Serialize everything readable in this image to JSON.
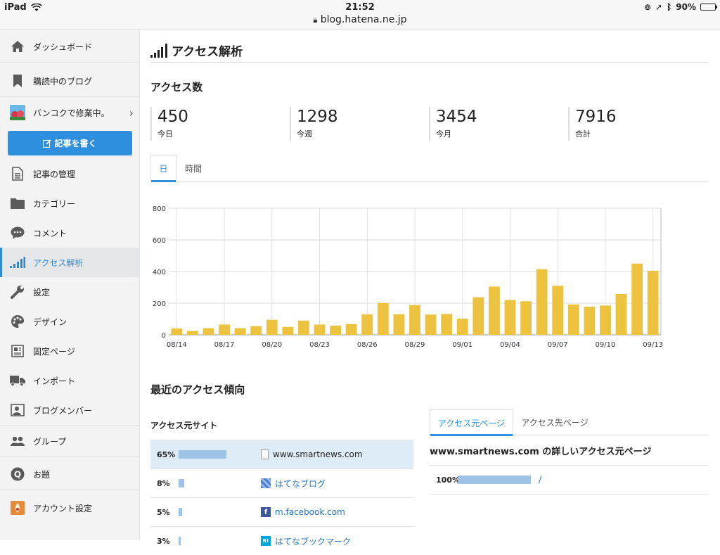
{
  "status_bar": {
    "device": "iPad",
    "time": "21:52",
    "url": "blog.hatena.ne.jp",
    "battery": "90%"
  },
  "sidebar": {
    "items": [
      {
        "label": "ダッシュボード",
        "icon": "home-icon"
      },
      {
        "label": "購読中のブログ",
        "icon": "bookmark-icon"
      },
      {
        "label": "バンコクで修業中。",
        "icon": "blog-avatar-icon"
      },
      {
        "label": "記事の管理",
        "icon": "document-icon"
      },
      {
        "label": "カテゴリー",
        "icon": "folder-icon"
      },
      {
        "label": "コメント",
        "icon": "comment-icon"
      },
      {
        "label": "アクセス解析",
        "icon": "signal-icon"
      },
      {
        "label": "設定",
        "icon": "wrench-icon"
      },
      {
        "label": "デザイン",
        "icon": "palette-icon"
      },
      {
        "label": "固定ページ",
        "icon": "page-icon"
      },
      {
        "label": "インポート",
        "icon": "truck-icon"
      },
      {
        "label": "ブログメンバー",
        "icon": "members-icon"
      },
      {
        "label": "グループ",
        "icon": "group-icon"
      },
      {
        "label": "お題",
        "icon": "question-icon"
      },
      {
        "label": "アカウント設定",
        "icon": "account-icon"
      }
    ],
    "write_button": "記事を書く"
  },
  "main": {
    "title": "アクセス解析",
    "access_heading": "アクセス数",
    "stats": [
      {
        "value": "450",
        "label": "今日"
      },
      {
        "value": "1298",
        "label": "今週"
      },
      {
        "value": "3454",
        "label": "今月"
      },
      {
        "value": "7916",
        "label": "合計"
      }
    ],
    "tabs": [
      "日",
      "時間"
    ],
    "trend_heading": "最近のアクセス傾向",
    "sources_heading": "アクセス元サイト",
    "sources": [
      {
        "pct": "65%",
        "value": 65,
        "site": "www.smartnews.com",
        "icon": "page-icon"
      },
      {
        "pct": "8%",
        "value": 8,
        "site": "はてなブログ",
        "icon": "hatena-blog-icon"
      },
      {
        "pct": "5%",
        "value": 5,
        "site": "m.facebook.com",
        "icon": "facebook-icon"
      },
      {
        "pct": "3%",
        "value": 3,
        "site": "はてなブックマーク",
        "icon": "hatena-bookmark-icon"
      }
    ],
    "right_tabs": [
      "アクセス元ページ",
      "アクセス先ページ"
    ],
    "detail_heading": "www.smartnews.com の詳しいアクセス元ページ",
    "detail_rows": [
      {
        "pct": "100%",
        "value": 100,
        "path": "/"
      }
    ]
  },
  "colors": {
    "accent": "#2d8fde",
    "bar": "#edc23f",
    "source_bar": "#9fc3e6"
  },
  "chart_data": {
    "type": "bar",
    "categories": [
      "08/14",
      "08/15",
      "08/16",
      "08/17",
      "08/18",
      "08/19",
      "08/20",
      "08/21",
      "08/22",
      "08/23",
      "08/24",
      "08/25",
      "08/26",
      "08/27",
      "08/28",
      "08/29",
      "08/30",
      "08/31",
      "09/01",
      "09/02",
      "09/03",
      "09/04",
      "09/05",
      "09/06",
      "09/07",
      "09/08",
      "09/09",
      "09/10",
      "09/11",
      "09/12",
      "09/13"
    ],
    "tick_labels": [
      "08/14",
      "08/17",
      "08/20",
      "08/23",
      "08/26",
      "08/29",
      "09/01",
      "09/04",
      "09/07",
      "09/10",
      "09/13"
    ],
    "values": [
      40,
      25,
      42,
      65,
      42,
      55,
      95,
      50,
      90,
      65,
      58,
      68,
      130,
      200,
      130,
      188,
      128,
      132,
      102,
      238,
      305,
      220,
      212,
      415,
      310,
      192,
      178,
      185,
      258,
      450,
      405
    ],
    "ylim": [
      0,
      800
    ],
    "yticks": [
      0,
      200,
      400,
      600,
      800
    ],
    "grid": true
  }
}
